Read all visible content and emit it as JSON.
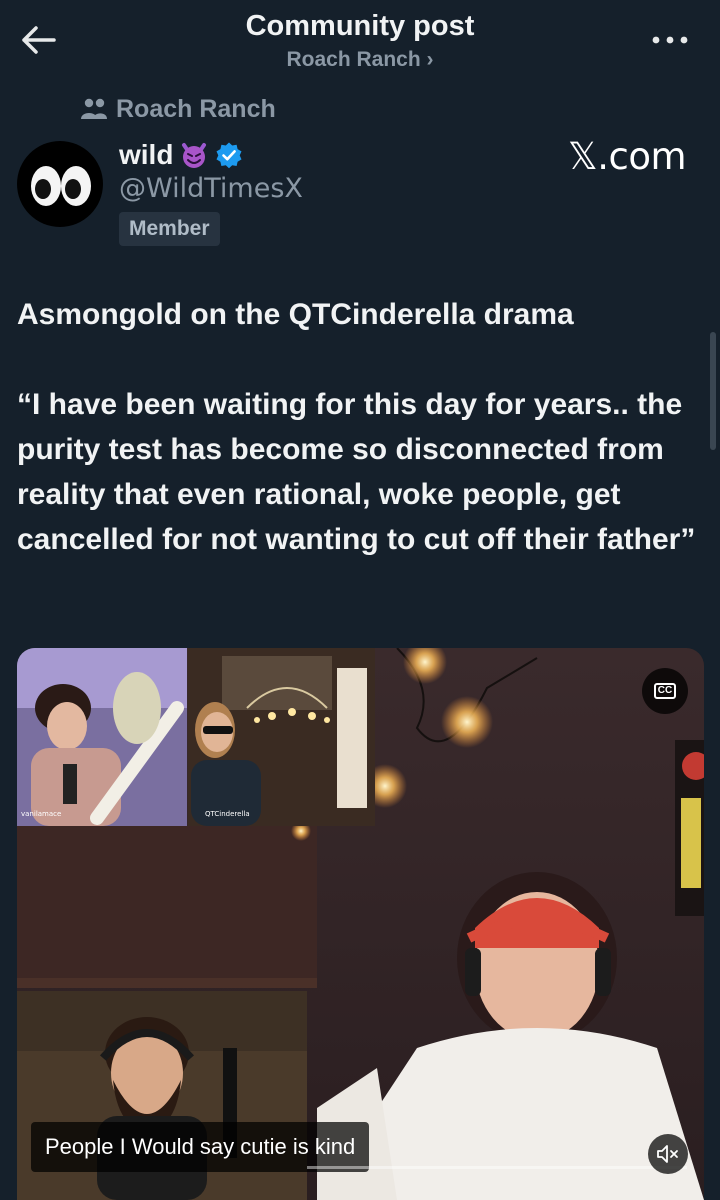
{
  "header": {
    "title": "Community post",
    "community_link": "Roach Ranch ›"
  },
  "community": {
    "name": "Roach Ranch",
    "icon": "people-icon"
  },
  "author": {
    "name": "wild",
    "emoji": "smiling-imp-emoji",
    "verified": true,
    "handle": "@WildTimesX",
    "badge": "Member",
    "avatar": "eyes-emoji"
  },
  "source_label": "𝕏.com",
  "post": {
    "headline": "Asmongold on the QTCinderella drama",
    "quote": "“I have been waiting for this day for years.. the purity test has become so disconnected from reality that even rational, woke people, get cancelled for not wanting to cut off their father”"
  },
  "media": {
    "type": "video",
    "caption": "People I Would say cutie is kind",
    "cc_label": "CC",
    "cam_labels": [
      "vanilamace",
      "QTCinderella"
    ],
    "controls": [
      "closed-captions-icon",
      "mute-icon"
    ]
  },
  "colors": {
    "background": "#15202b",
    "secondary_text": "#8b98a5",
    "verified": "#1d9bf0"
  }
}
